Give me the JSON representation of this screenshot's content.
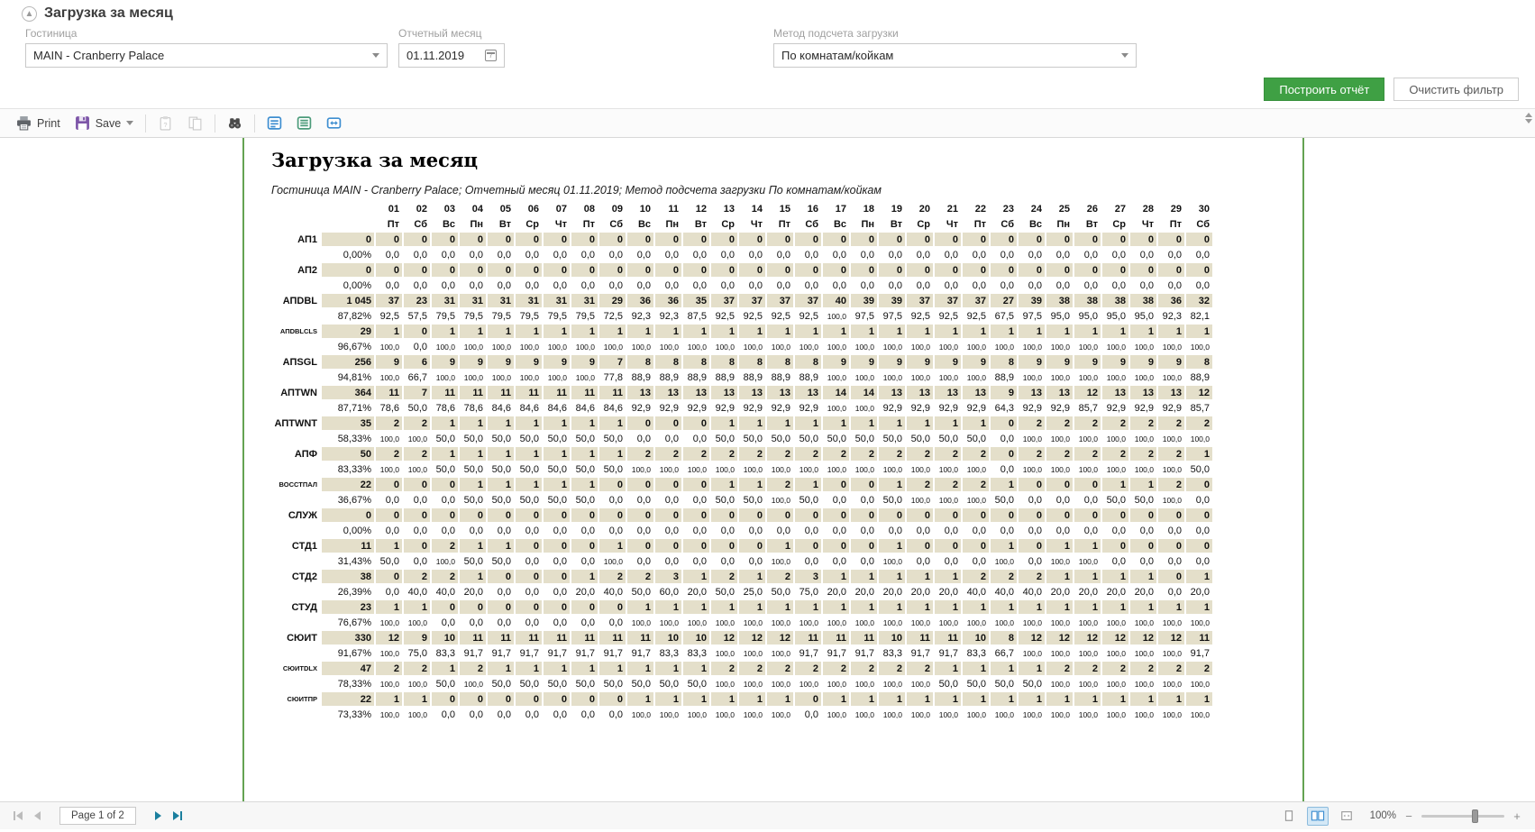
{
  "panel": {
    "title": "Загрузка за месяц"
  },
  "filters": {
    "hotel": {
      "label": "Гостиница",
      "value": "MAIN - Cranberry Palace"
    },
    "month": {
      "label": "Отчетный месяц",
      "value": "01.11.2019"
    },
    "method": {
      "label": "Метод подсчета загрузки",
      "value": "По комнатам/койкам"
    }
  },
  "actions": {
    "build": "Построить отчёт",
    "clear": "Очистить фильтр"
  },
  "toolbar": {
    "print": "Print",
    "save": "Save"
  },
  "report": {
    "title": "Загрузка за месяц",
    "subtitle": "Гостиница MAIN - Cranberry Palace; Отчетный месяц 01.11.2019; Метод подсчета загрузки По комнатам/койкам",
    "days": [
      "01",
      "02",
      "03",
      "04",
      "05",
      "06",
      "07",
      "08",
      "09",
      "10",
      "11",
      "12",
      "13",
      "14",
      "15",
      "16",
      "17",
      "18",
      "19",
      "20",
      "21",
      "22",
      "23",
      "24",
      "25",
      "26",
      "27",
      "28",
      "29",
      "30"
    ],
    "weekdays": [
      "Пт",
      "Сб",
      "Вс",
      "Пн",
      "Вт",
      "Ср",
      "Чт",
      "Пт",
      "Сб",
      "Вс",
      "Пн",
      "Вт",
      "Ср",
      "Чт",
      "Пт",
      "Сб",
      "Вс",
      "Пн",
      "Вт",
      "Ср",
      "Чт",
      "Пт",
      "Сб",
      "Вс",
      "Пн",
      "Вт",
      "Ср",
      "Чт",
      "Пт",
      "Сб"
    ],
    "rows": [
      {
        "label": "АП1",
        "small": false,
        "total": "0",
        "total_pct": "0,00%",
        "counts": [
          0,
          0,
          0,
          0,
          0,
          0,
          0,
          0,
          0,
          0,
          0,
          0,
          0,
          0,
          0,
          0,
          0,
          0,
          0,
          0,
          0,
          0,
          0,
          0,
          0,
          0,
          0,
          0,
          0,
          0
        ],
        "pcts": [
          "0,0",
          "0,0",
          "0,0",
          "0,0",
          "0,0",
          "0,0",
          "0,0",
          "0,0",
          "0,0",
          "0,0",
          "0,0",
          "0,0",
          "0,0",
          "0,0",
          "0,0",
          "0,0",
          "0,0",
          "0,0",
          "0,0",
          "0,0",
          "0,0",
          "0,0",
          "0,0",
          "0,0",
          "0,0",
          "0,0",
          "0,0",
          "0,0",
          "0,0",
          "0,0"
        ]
      },
      {
        "label": "АП2",
        "small": false,
        "total": "0",
        "total_pct": "0,00%",
        "counts": [
          0,
          0,
          0,
          0,
          0,
          0,
          0,
          0,
          0,
          0,
          0,
          0,
          0,
          0,
          0,
          0,
          0,
          0,
          0,
          0,
          0,
          0,
          0,
          0,
          0,
          0,
          0,
          0,
          0,
          0
        ],
        "pcts": [
          "0,0",
          "0,0",
          "0,0",
          "0,0",
          "0,0",
          "0,0",
          "0,0",
          "0,0",
          "0,0",
          "0,0",
          "0,0",
          "0,0",
          "0,0",
          "0,0",
          "0,0",
          "0,0",
          "0,0",
          "0,0",
          "0,0",
          "0,0",
          "0,0",
          "0,0",
          "0,0",
          "0,0",
          "0,0",
          "0,0",
          "0,0",
          "0,0",
          "0,0",
          "0,0"
        ]
      },
      {
        "label": "АПDBL",
        "small": false,
        "total": "1 045",
        "total_pct": "87,82%",
        "counts": [
          37,
          23,
          31,
          31,
          31,
          31,
          31,
          31,
          29,
          36,
          36,
          35,
          37,
          37,
          37,
          37,
          40,
          39,
          39,
          37,
          37,
          37,
          27,
          39,
          38,
          38,
          38,
          38,
          36,
          32
        ],
        "pcts": [
          "92,5",
          "57,5",
          "79,5",
          "79,5",
          "79,5",
          "79,5",
          "79,5",
          "79,5",
          "72,5",
          "92,3",
          "92,3",
          "87,5",
          "92,5",
          "92,5",
          "92,5",
          "92,5",
          "100,0",
          "97,5",
          "97,5",
          "92,5",
          "92,5",
          "92,5",
          "67,5",
          "97,5",
          "95,0",
          "95,0",
          "95,0",
          "95,0",
          "92,3",
          "82,1"
        ]
      },
      {
        "label": "АПDBLCLS",
        "small": true,
        "total": "29",
        "total_pct": "96,67%",
        "counts": [
          1,
          0,
          1,
          1,
          1,
          1,
          1,
          1,
          1,
          1,
          1,
          1,
          1,
          1,
          1,
          1,
          1,
          1,
          1,
          1,
          1,
          1,
          1,
          1,
          1,
          1,
          1,
          1,
          1,
          1
        ],
        "pcts": [
          "100,0",
          "0,0",
          "100,0",
          "100,0",
          "100,0",
          "100,0",
          "100,0",
          "100,0",
          "100,0",
          "100,0",
          "100,0",
          "100,0",
          "100,0",
          "100,0",
          "100,0",
          "100,0",
          "100,0",
          "100,0",
          "100,0",
          "100,0",
          "100,0",
          "100,0",
          "100,0",
          "100,0",
          "100,0",
          "100,0",
          "100,0",
          "100,0",
          "100,0",
          "100,0"
        ]
      },
      {
        "label": "АПSGL",
        "small": false,
        "total": "256",
        "total_pct": "94,81%",
        "counts": [
          9,
          6,
          9,
          9,
          9,
          9,
          9,
          9,
          7,
          8,
          8,
          8,
          8,
          8,
          8,
          8,
          9,
          9,
          9,
          9,
          9,
          9,
          8,
          9,
          9,
          9,
          9,
          9,
          9,
          8
        ],
        "pcts": [
          "100,0",
          "66,7",
          "100,0",
          "100,0",
          "100,0",
          "100,0",
          "100,0",
          "100,0",
          "77,8",
          "88,9",
          "88,9",
          "88,9",
          "88,9",
          "88,9",
          "88,9",
          "88,9",
          "100,0",
          "100,0",
          "100,0",
          "100,0",
          "100,0",
          "100,0",
          "88,9",
          "100,0",
          "100,0",
          "100,0",
          "100,0",
          "100,0",
          "100,0",
          "88,9"
        ]
      },
      {
        "label": "АПTWN",
        "small": false,
        "total": "364",
        "total_pct": "87,71%",
        "counts": [
          11,
          7,
          11,
          11,
          11,
          11,
          11,
          11,
          11,
          13,
          13,
          13,
          13,
          13,
          13,
          13,
          14,
          14,
          13,
          13,
          13,
          13,
          9,
          13,
          13,
          12,
          13,
          13,
          13,
          12
        ],
        "pcts": [
          "78,6",
          "50,0",
          "78,6",
          "78,6",
          "84,6",
          "84,6",
          "84,6",
          "84,6",
          "84,6",
          "92,9",
          "92,9",
          "92,9",
          "92,9",
          "92,9",
          "92,9",
          "92,9",
          "100,0",
          "100,0",
          "92,9",
          "92,9",
          "92,9",
          "92,9",
          "64,3",
          "92,9",
          "92,9",
          "85,7",
          "92,9",
          "92,9",
          "92,9",
          "85,7"
        ]
      },
      {
        "label": "АПTWNT",
        "small": false,
        "total": "35",
        "total_pct": "58,33%",
        "counts": [
          2,
          2,
          1,
          1,
          1,
          1,
          1,
          1,
          1,
          0,
          0,
          0,
          1,
          1,
          1,
          1,
          1,
          1,
          1,
          1,
          1,
          1,
          0,
          2,
          2,
          2,
          2,
          2,
          2,
          2
        ],
        "pcts": [
          "100,0",
          "100,0",
          "50,0",
          "50,0",
          "50,0",
          "50,0",
          "50,0",
          "50,0",
          "50,0",
          "0,0",
          "0,0",
          "0,0",
          "50,0",
          "50,0",
          "50,0",
          "50,0",
          "50,0",
          "50,0",
          "50,0",
          "50,0",
          "50,0",
          "50,0",
          "0,0",
          "100,0",
          "100,0",
          "100,0",
          "100,0",
          "100,0",
          "100,0",
          "100,0"
        ]
      },
      {
        "label": "АПФ",
        "small": false,
        "total": "50",
        "total_pct": "83,33%",
        "counts": [
          2,
          2,
          1,
          1,
          1,
          1,
          1,
          1,
          1,
          2,
          2,
          2,
          2,
          2,
          2,
          2,
          2,
          2,
          2,
          2,
          2,
          2,
          0,
          2,
          2,
          2,
          2,
          2,
          2,
          1
        ],
        "pcts": [
          "100,0",
          "100,0",
          "50,0",
          "50,0",
          "50,0",
          "50,0",
          "50,0",
          "50,0",
          "50,0",
          "100,0",
          "100,0",
          "100,0",
          "100,0",
          "100,0",
          "100,0",
          "100,0",
          "100,0",
          "100,0",
          "100,0",
          "100,0",
          "100,0",
          "100,0",
          "0,0",
          "100,0",
          "100,0",
          "100,0",
          "100,0",
          "100,0",
          "100,0",
          "50,0"
        ]
      },
      {
        "label": "ВОССТПАЛ",
        "small": true,
        "total": "22",
        "total_pct": "36,67%",
        "counts": [
          0,
          0,
          0,
          1,
          1,
          1,
          1,
          1,
          0,
          0,
          0,
          0,
          1,
          1,
          2,
          1,
          0,
          0,
          1,
          2,
          2,
          2,
          1,
          0,
          0,
          0,
          1,
          1,
          2,
          0
        ],
        "pcts": [
          "0,0",
          "0,0",
          "0,0",
          "50,0",
          "50,0",
          "50,0",
          "50,0",
          "50,0",
          "0,0",
          "0,0",
          "0,0",
          "0,0",
          "50,0",
          "50,0",
          "100,0",
          "50,0",
          "0,0",
          "0,0",
          "50,0",
          "100,0",
          "100,0",
          "100,0",
          "50,0",
          "0,0",
          "0,0",
          "0,0",
          "50,0",
          "50,0",
          "100,0",
          "0,0"
        ]
      },
      {
        "label": "СЛУЖ",
        "small": false,
        "total": "0",
        "total_pct": "0,00%",
        "counts": [
          0,
          0,
          0,
          0,
          0,
          0,
          0,
          0,
          0,
          0,
          0,
          0,
          0,
          0,
          0,
          0,
          0,
          0,
          0,
          0,
          0,
          0,
          0,
          0,
          0,
          0,
          0,
          0,
          0,
          0
        ],
        "pcts": [
          "0,0",
          "0,0",
          "0,0",
          "0,0",
          "0,0",
          "0,0",
          "0,0",
          "0,0",
          "0,0",
          "0,0",
          "0,0",
          "0,0",
          "0,0",
          "0,0",
          "0,0",
          "0,0",
          "0,0",
          "0,0",
          "0,0",
          "0,0",
          "0,0",
          "0,0",
          "0,0",
          "0,0",
          "0,0",
          "0,0",
          "0,0",
          "0,0",
          "0,0",
          "0,0"
        ]
      },
      {
        "label": "СТД1",
        "small": false,
        "total": "11",
        "total_pct": "31,43%",
        "counts": [
          1,
          0,
          2,
          1,
          1,
          0,
          0,
          0,
          1,
          0,
          0,
          0,
          0,
          0,
          1,
          0,
          0,
          0,
          1,
          0,
          0,
          0,
          1,
          0,
          1,
          1,
          0,
          0,
          0,
          0
        ],
        "pcts": [
          "50,0",
          "0,0",
          "100,0",
          "50,0",
          "50,0",
          "0,0",
          "0,0",
          "0,0",
          "100,0",
          "0,0",
          "0,0",
          "0,0",
          "0,0",
          "0,0",
          "100,0",
          "0,0",
          "0,0",
          "0,0",
          "100,0",
          "0,0",
          "0,0",
          "0,0",
          "100,0",
          "0,0",
          "100,0",
          "100,0",
          "0,0",
          "0,0",
          "0,0",
          "0,0"
        ]
      },
      {
        "label": "СТД2",
        "small": false,
        "total": "38",
        "total_pct": "26,39%",
        "counts": [
          0,
          2,
          2,
          1,
          0,
          0,
          0,
          1,
          2,
          2,
          3,
          1,
          2,
          1,
          2,
          3,
          1,
          1,
          1,
          1,
          1,
          2,
          2,
          2,
          1,
          1,
          1,
          1,
          0,
          1
        ],
        "pcts": [
          "0,0",
          "40,0",
          "40,0",
          "20,0",
          "0,0",
          "0,0",
          "0,0",
          "20,0",
          "40,0",
          "50,0",
          "60,0",
          "20,0",
          "50,0",
          "25,0",
          "50,0",
          "75,0",
          "20,0",
          "20,0",
          "20,0",
          "20,0",
          "20,0",
          "40,0",
          "40,0",
          "40,0",
          "20,0",
          "20,0",
          "20,0",
          "20,0",
          "0,0",
          "20,0"
        ]
      },
      {
        "label": "СТУД",
        "small": false,
        "total": "23",
        "total_pct": "76,67%",
        "counts": [
          1,
          1,
          0,
          0,
          0,
          0,
          0,
          0,
          0,
          1,
          1,
          1,
          1,
          1,
          1,
          1,
          1,
          1,
          1,
          1,
          1,
          1,
          1,
          1,
          1,
          1,
          1,
          1,
          1,
          1
        ],
        "pcts": [
          "100,0",
          "100,0",
          "0,0",
          "0,0",
          "0,0",
          "0,0",
          "0,0",
          "0,0",
          "0,0",
          "100,0",
          "100,0",
          "100,0",
          "100,0",
          "100,0",
          "100,0",
          "100,0",
          "100,0",
          "100,0",
          "100,0",
          "100,0",
          "100,0",
          "100,0",
          "100,0",
          "100,0",
          "100,0",
          "100,0",
          "100,0",
          "100,0",
          "100,0",
          "100,0"
        ]
      },
      {
        "label": "СЮИТ",
        "small": false,
        "total": "330",
        "total_pct": "91,67%",
        "counts": [
          12,
          9,
          10,
          11,
          11,
          11,
          11,
          11,
          11,
          11,
          10,
          10,
          12,
          12,
          12,
          11,
          11,
          11,
          10,
          11,
          11,
          10,
          8,
          12,
          12,
          12,
          12,
          12,
          12,
          11
        ],
        "pcts": [
          "100,0",
          "75,0",
          "83,3",
          "91,7",
          "91,7",
          "91,7",
          "91,7",
          "91,7",
          "91,7",
          "91,7",
          "83,3",
          "83,3",
          "100,0",
          "100,0",
          "100,0",
          "91,7",
          "91,7",
          "91,7",
          "83,3",
          "91,7",
          "91,7",
          "83,3",
          "66,7",
          "100,0",
          "100,0",
          "100,0",
          "100,0",
          "100,0",
          "100,0",
          "91,7"
        ]
      },
      {
        "label": "СЮИТDLX",
        "small": true,
        "total": "47",
        "total_pct": "78,33%",
        "counts": [
          2,
          2,
          1,
          2,
          1,
          1,
          1,
          1,
          1,
          1,
          1,
          1,
          2,
          2,
          2,
          2,
          2,
          2,
          2,
          2,
          1,
          1,
          1,
          1,
          2,
          2,
          2,
          2,
          2,
          2
        ],
        "pcts": [
          "100,0",
          "100,0",
          "50,0",
          "100,0",
          "50,0",
          "50,0",
          "50,0",
          "50,0",
          "50,0",
          "50,0",
          "50,0",
          "50,0",
          "100,0",
          "100,0",
          "100,0",
          "100,0",
          "100,0",
          "100,0",
          "100,0",
          "100,0",
          "50,0",
          "50,0",
          "50,0",
          "50,0",
          "100,0",
          "100,0",
          "100,0",
          "100,0",
          "100,0",
          "100,0"
        ]
      },
      {
        "label": "СЮИТПР",
        "small": true,
        "total": "22",
        "total_pct": "73,33%",
        "counts": [
          1,
          1,
          0,
          0,
          0,
          0,
          0,
          0,
          0,
          1,
          1,
          1,
          1,
          1,
          1,
          0,
          1,
          1,
          1,
          1,
          1,
          1,
          1,
          1,
          1,
          1,
          1,
          1,
          1,
          1
        ],
        "pcts": [
          "100,0",
          "100,0",
          "0,0",
          "0,0",
          "0,0",
          "0,0",
          "0,0",
          "0,0",
          "0,0",
          "100,0",
          "100,0",
          "100,0",
          "100,0",
          "100,0",
          "100,0",
          "0,0",
          "100,0",
          "100,0",
          "100,0",
          "100,0",
          "100,0",
          "100,0",
          "100,0",
          "100,0",
          "100,0",
          "100,0",
          "100,0",
          "100,0",
          "100,0",
          "100,0"
        ]
      }
    ]
  },
  "pager": {
    "label": "Page 1 of 2"
  },
  "zoomctl": {
    "level": "100%"
  }
}
